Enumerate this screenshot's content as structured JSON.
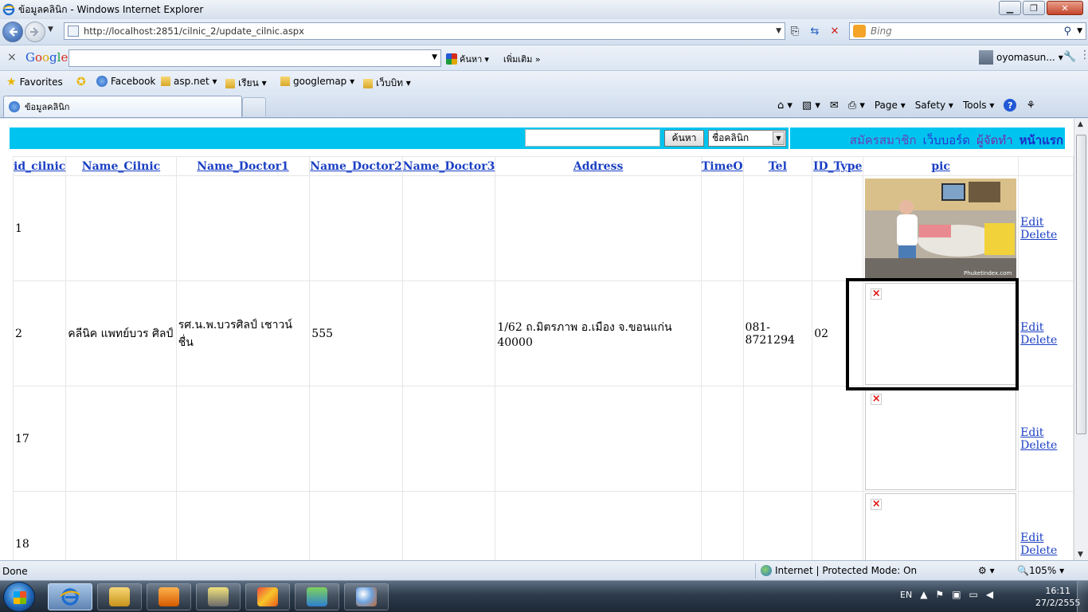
{
  "window": {
    "title": "ข้อมูลคลินิก - Windows Internet Explorer",
    "controls": {
      "minimize": "▁",
      "maximize": "❐",
      "close": "✕"
    }
  },
  "address": {
    "url": "http://localhost:2851/cilnic_2/update_cilnic.aspx",
    "search_placeholder": "Bing"
  },
  "google_toolbar": {
    "logo": [
      "G",
      "o",
      "o",
      "g",
      "l",
      "e"
    ],
    "search_label": "ค้นหา",
    "more_label": "เพิ่มเติม »",
    "user": "oyomasun..."
  },
  "favorites": {
    "label": "Favorites",
    "items": [
      "Facebook",
      "asp.net ▾",
      "เรียน ▾",
      "googlemap ▾",
      "เว็บบิท ▾"
    ]
  },
  "tab": {
    "label": "ข้อมูลคลินิก"
  },
  "command_bar": {
    "page": "Page ▾",
    "safety": "Safety ▾",
    "tools": "Tools ▾"
  },
  "site": {
    "search_button": "ค้นหา",
    "search_select": "ชื่อคลินิก",
    "links": [
      "สมัครสมาชิก",
      "เว็บบอร์ด",
      "ผู้จัดทำ",
      "หน้าแรก"
    ]
  },
  "grid": {
    "headers": [
      "id_cilnic",
      "Name_Cilnic",
      "Name_Doctor1",
      "Name_Doctor2",
      "Name_Doctor3",
      "Address",
      "TimeO",
      "Tel",
      "ID_Type",
      "pic"
    ],
    "rows": [
      {
        "id": "1",
        "name": "",
        "doctor1": "",
        "doctor2": "",
        "doctor3": "",
        "address": "",
        "time": "",
        "tel": "",
        "type": "",
        "pic": "photo",
        "edit": "Edit",
        "delete": "Delete"
      },
      {
        "id": "2",
        "name": "คลีนิค แพทย์บวร ศิลป์",
        "doctor1": "รศ.น.พ.บวรศิลป์ เชาวน์ ชื่น",
        "doctor2": "555",
        "doctor3": "",
        "address": "1/62 ถ.มิตรภาพ อ.เมือง จ.ขอนแก่น 40000",
        "time": "",
        "tel": "081-8721294",
        "type": "02",
        "pic": "broken",
        "edit": "Edit",
        "delete": "Delete"
      },
      {
        "id": "17",
        "name": "",
        "doctor1": "",
        "doctor2": "",
        "doctor3": "",
        "address": "",
        "time": "",
        "tel": "",
        "type": "",
        "pic": "broken",
        "edit": "Edit",
        "delete": "Delete"
      },
      {
        "id": "18",
        "name": "",
        "doctor1": "",
        "doctor2": "",
        "doctor3": "",
        "address": "",
        "time": "",
        "tel": "",
        "type": "",
        "pic": "broken",
        "edit": "Edit",
        "delete": "Delete"
      }
    ],
    "photo_watermark": "Phuketindex.com"
  },
  "status": {
    "left": "Done",
    "zone": "Internet | Protected Mode: On",
    "zoom": "🔍105% ▾"
  },
  "taskbar": {
    "language": "EN",
    "time": "16:11",
    "date": "27/2/2555"
  },
  "colors": {
    "cyan_bar": "#00c4ef",
    "link": "#1a3fc4"
  }
}
